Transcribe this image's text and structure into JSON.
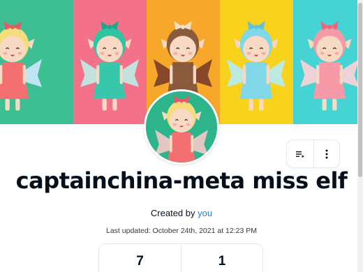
{
  "banner": {
    "stripes": [
      {
        "bg": "#3dbf93",
        "hair": "#f4dd7a",
        "dress": "#f46f6f",
        "bow": "#e35a6a",
        "wing": "#cfe8ff"
      },
      {
        "bg": "#f3728a",
        "hair": "#2fc5a3",
        "dress": "#39c7ab",
        "bow": "#1ea88a",
        "wing": "#bfeee6"
      },
      {
        "bg": "#f7a82a",
        "hair": "#8a5a3c",
        "dress": "#8a5a3c",
        "bow": "#f2dfc8",
        "wing": "#7a3d2a"
      },
      {
        "bg": "#f8d21c",
        "hair": "#7fd7e8",
        "dress": "#7fd7e8",
        "bow": "#5fc4db",
        "wing": "#b6ecf5"
      },
      {
        "bg": "#46d3d3",
        "hair": "#f59aa6",
        "dress": "#f59aa6",
        "bow": "#e8697c",
        "wing": "#ffd1d8"
      },
      {
        "bg": "#1e9cf0",
        "hair": "#333333",
        "dress": "#f2f2f2",
        "bow": "#222222",
        "wing": "#cccccc"
      }
    ]
  },
  "avatar": {
    "bg": "#2db48a",
    "hair": "#f4dd7a",
    "dress": "#f46f6f",
    "bow": "#e35a6a",
    "wing": "#f6c9c9"
  },
  "collection": {
    "title": "captainchina-meta miss elf",
    "created_prefix": "Created by ",
    "created_link": "you",
    "last_updated": "Last updated: October 24th, 2021 at 12:23 PM"
  },
  "stats": [
    {
      "value": "7"
    },
    {
      "value": "1"
    }
  ],
  "actions": {
    "icons": [
      "playlist-icon",
      "more-vertical-icon"
    ]
  }
}
